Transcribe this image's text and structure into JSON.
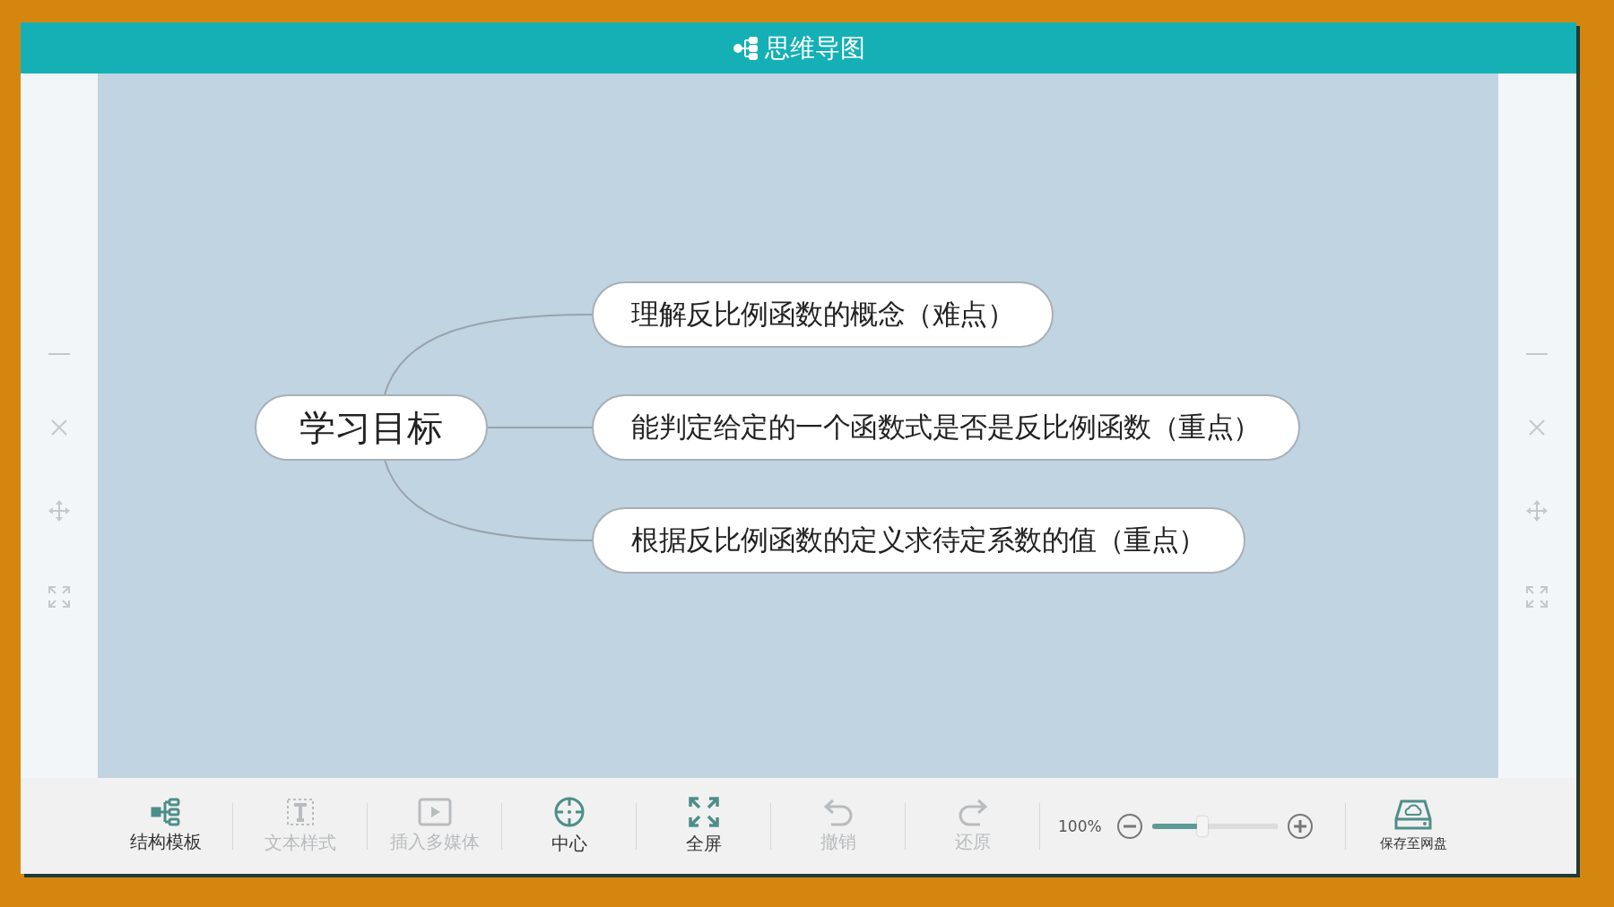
{
  "window": {
    "title": "思维导图"
  },
  "mindmap": {
    "root": {
      "label": "学习目标"
    },
    "children": [
      {
        "label": "理解反比例函数的概念（难点）"
      },
      {
        "label": "能判定给定的一个函数式是否是反比例函数（重点）"
      },
      {
        "label": "根据反比例函数的定义求待定系数的值（重点）"
      }
    ]
  },
  "toolbar": {
    "items": [
      {
        "kind": "tool",
        "label": "结构模板",
        "disabled": false
      },
      {
        "kind": "tool",
        "label": "文本样式",
        "disabled": true
      },
      {
        "kind": "tool",
        "label": "插入多媒体",
        "disabled": true
      },
      {
        "kind": "tool",
        "label": "中心",
        "disabled": false
      },
      {
        "kind": "tool",
        "label": "全屏",
        "disabled": false
      },
      {
        "kind": "tool",
        "label": "撤销",
        "disabled": true
      },
      {
        "kind": "tool",
        "label": "还原",
        "disabled": true
      },
      {
        "kind": "zoom",
        "reading": "100%",
        "level": 0.4
      },
      {
        "kind": "save",
        "label": "保存至网盘"
      }
    ]
  }
}
